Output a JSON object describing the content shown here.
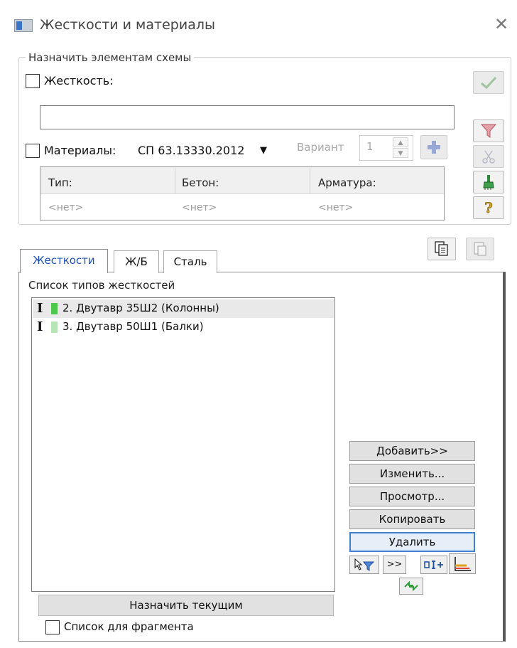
{
  "window": {
    "title": "Жесткости и материалы",
    "close_glyph": "✕",
    "icon": "window-app-icon"
  },
  "assign_group": {
    "legend": "Назначить элементам схемы",
    "stiffness_label": "Жесткость:",
    "stiffness_checked": false,
    "stiffness_value": "",
    "materials_label": "Материалы:",
    "materials_checked": false,
    "norm_value": "СП 63.13330.2012",
    "norm_arrow": "▼",
    "variant_label": "Вариант",
    "variant_value": "1",
    "table": {
      "headers": [
        "Тип:",
        "Бетон:",
        "Арматура:"
      ],
      "values": [
        "<нет>",
        "<нет>",
        "<нет>"
      ]
    }
  },
  "tabs": [
    {
      "label": "Жесткости",
      "active": true
    },
    {
      "label": "Ж/Б",
      "active": false
    },
    {
      "label": "Сталь",
      "active": false
    }
  ],
  "stiffness_list": {
    "caption": "Список типов жесткостей",
    "items": [
      {
        "label": "2. Двутавр 35Ш2 (Колонны)",
        "glyph": "I",
        "color": "#4cc94c",
        "selected": true
      },
      {
        "label": "3. Двутавр 50Ш1 (Балки)",
        "glyph": "I",
        "color": "#b6e6b6",
        "selected": false
      }
    ]
  },
  "buttons": {
    "add": "Добавить>>",
    "edit": "Изменить...",
    "view": "Просмотр...",
    "copy": "Копировать",
    "delete": "Удалить",
    "move": ">>",
    "assign_current": "Назначить текущим"
  },
  "fragment": {
    "label": "Список для фрагмента",
    "checked": false
  },
  "colors": {
    "active_tab_text": "#1e50b4",
    "delete_border": "#3f7fd6",
    "accent_green": "#4cc94c"
  }
}
